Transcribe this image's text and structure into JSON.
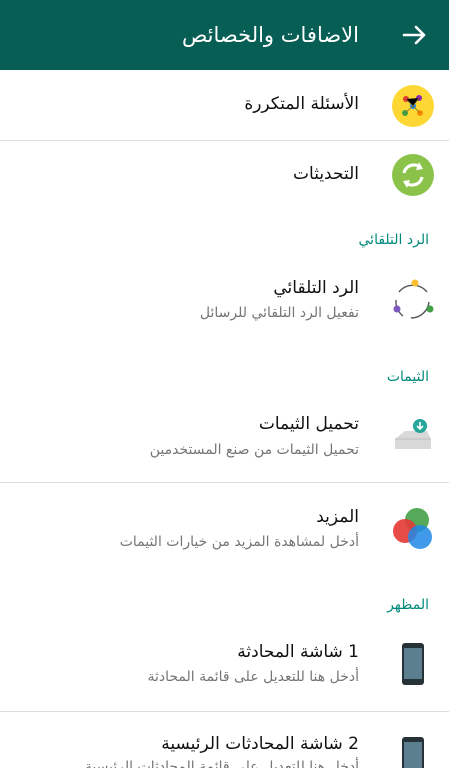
{
  "header": {
    "title": "الاضافات والخصائص",
    "back_icon": "arrow-forward-icon",
    "background": "#075e54"
  },
  "items": {
    "faq": {
      "title": "الأسئلة المتكررة",
      "icon": "faq-dots-icon"
    },
    "updates": {
      "title": "التحديثات",
      "icon": "refresh-sync-icon"
    },
    "auto_reply": {
      "title": "الرد التلقائي",
      "subtitle": "تفعيل الرد التلقائي للرسائل",
      "icon": "auto-reply-cycle-icon"
    },
    "load_themes": {
      "title": "تحميل الثيمات",
      "subtitle": "تحميل الثيمات من صنع المستخدمين",
      "icon": "theme-download-icon"
    },
    "more": {
      "title": "المزيد",
      "subtitle": "أدخل لمشاهدة المزيد من خيارات الثيمات",
      "icon": "color-circles-icon"
    },
    "chat_screen_1": {
      "title": "1 شاشة المحادثة",
      "subtitle": "أدخل هنا للتعديل على قائمة المحادثة",
      "icon": "phone-icon"
    },
    "chat_screen_2": {
      "title": "2 شاشة المحادثات الرئيسية",
      "subtitle": "أدخل هنا للتعديل على قائمة المحادثات الرئيسية",
      "icon": "phone-icon"
    }
  },
  "sections": {
    "auto_reply": "الرد التلقائي",
    "themes": "الثيمات",
    "appearance": "المظهر"
  },
  "colors": {
    "accent": "#00897b",
    "updates_green": "#8bc34a",
    "faq_yellow": "#fdd835"
  }
}
